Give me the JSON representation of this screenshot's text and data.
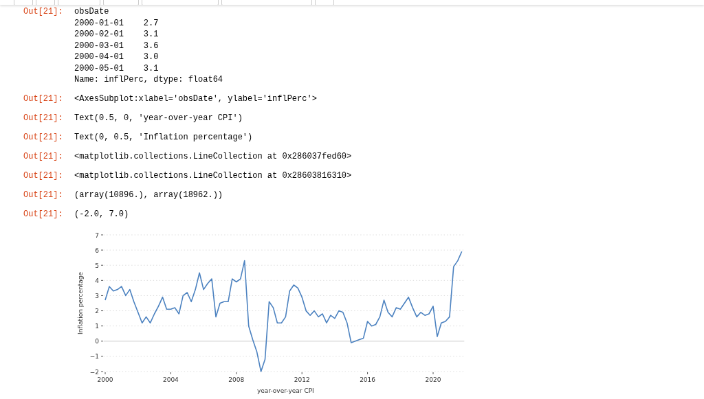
{
  "outputs": [
    {
      "prompt": "Out[21]:",
      "kind": "block",
      "lines": [
        "obsDate",
        "2000-01-01    2.7",
        "2000-02-01    3.1",
        "2000-03-01    3.6",
        "2000-04-01    3.0",
        "2000-05-01    3.1",
        "Name: inflPerc, dtype: float64"
      ]
    },
    {
      "prompt": "Out[21]:",
      "kind": "line",
      "text": "<AxesSubplot:xlabel='obsDate', ylabel='inflPerc'>"
    },
    {
      "prompt": "Out[21]:",
      "kind": "line",
      "text": "Text(0.5, 0, 'year-over-year CPI')"
    },
    {
      "prompt": "Out[21]:",
      "kind": "line",
      "text": "Text(0, 0.5, 'Inflation percentage')"
    },
    {
      "prompt": "Out[21]:",
      "kind": "line",
      "text": "<matplotlib.collections.LineCollection at 0x286037fed60>"
    },
    {
      "prompt": "Out[21]:",
      "kind": "line",
      "text": "<matplotlib.collections.LineCollection at 0x28603816310>"
    },
    {
      "prompt": "Out[21]:",
      "kind": "line",
      "text": "(array(10896.), array(18962.))"
    },
    {
      "prompt": "Out[21]:",
      "kind": "line",
      "text": "(-2.0, 7.0)"
    }
  ],
  "figure": {
    "chart_data": {
      "type": "line",
      "xlabel": "year-over-year CPI",
      "ylabel": "Inflation percentage",
      "x": [
        2000,
        2000.25,
        2000.5,
        2000.75,
        2001,
        2001.25,
        2001.5,
        2001.75,
        2002,
        2002.25,
        2002.5,
        2002.75,
        2003,
        2003.25,
        2003.5,
        2003.75,
        2004,
        2004.25,
        2004.5,
        2004.75,
        2005,
        2005.25,
        2005.5,
        2005.75,
        2006,
        2006.25,
        2006.5,
        2006.75,
        2007,
        2007.25,
        2007.5,
        2007.75,
        2008,
        2008.25,
        2008.5,
        2008.75,
        2009,
        2009.25,
        2009.5,
        2009.75,
        2010,
        2010.25,
        2010.5,
        2010.75,
        2011,
        2011.25,
        2011.5,
        2011.75,
        2012,
        2012.25,
        2012.5,
        2012.75,
        2013,
        2013.25,
        2013.5,
        2013.75,
        2014,
        2014.25,
        2014.5,
        2014.75,
        2015,
        2015.25,
        2015.5,
        2015.75,
        2016,
        2016.25,
        2016.5,
        2016.75,
        2017,
        2017.25,
        2017.5,
        2017.75,
        2018,
        2018.25,
        2018.5,
        2018.75,
        2019,
        2019.25,
        2019.5,
        2019.75,
        2020,
        2020.25,
        2020.5,
        2020.75,
        2021,
        2021.25,
        2021.5,
        2021.75
      ],
      "series": [
        {
          "color": "#4c82c0",
          "values": [
            2.7,
            3.6,
            3.3,
            3.4,
            3.6,
            3.0,
            3.4,
            2.6,
            1.9,
            1.2,
            1.6,
            1.2,
            1.8,
            2.3,
            2.9,
            2.1,
            2.1,
            2.2,
            1.8,
            3.0,
            3.2,
            2.6,
            3.4,
            4.5,
            3.4,
            3.8,
            4.1,
            1.6,
            2.5,
            2.6,
            2.6,
            4.1,
            3.9,
            4.1,
            5.3,
            1.0,
            0.1,
            -0.7,
            -2.0,
            -1.2,
            2.6,
            2.2,
            1.2,
            1.2,
            1.6,
            3.3,
            3.7,
            3.5,
            2.9,
            2.0,
            1.7,
            2.0,
            1.6,
            1.8,
            1.2,
            1.7,
            1.5,
            2.0,
            1.9,
            1.2,
            -0.1,
            0.0,
            0.1,
            0.2,
            1.3,
            1.0,
            1.1,
            1.6,
            2.7,
            1.9,
            1.6,
            2.2,
            2.1,
            2.5,
            2.9,
            2.2,
            1.6,
            1.9,
            1.7,
            1.8,
            2.3,
            0.3,
            1.2,
            1.3,
            1.6,
            4.9,
            5.3,
            5.9
          ]
        }
      ],
      "grid": true,
      "xlim": [
        1999.9,
        2021.9
      ],
      "ylim": [
        -2,
        7
      ],
      "xticks": [
        2000,
        2004,
        2008,
        2012,
        2016,
        2020
      ],
      "yticks": [
        {
          "value": -2,
          "label": "−2"
        },
        {
          "value": -1,
          "label": "−1"
        },
        0,
        1,
        2,
        3,
        4,
        5,
        6,
        7
      ]
    }
  }
}
